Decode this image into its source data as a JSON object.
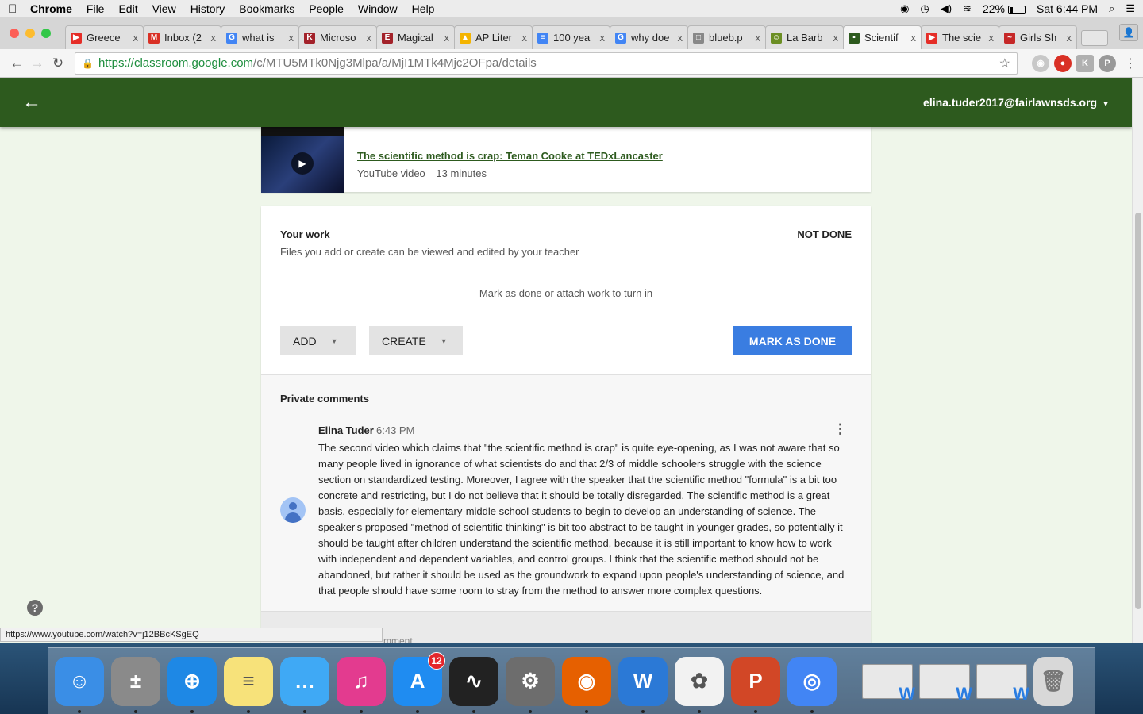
{
  "menubar": {
    "apple": "",
    "app_name": "Chrome",
    "items": [
      "File",
      "Edit",
      "View",
      "History",
      "Bookmarks",
      "People",
      "Window",
      "Help"
    ],
    "battery_percent": "22%",
    "clock": "Sat 6:44 PM"
  },
  "tabs": [
    {
      "label": "Greece",
      "fav_color": "#e52d27",
      "fav_glyph": "▶"
    },
    {
      "label": "Inbox (2",
      "fav_color": "#d93025",
      "fav_glyph": "M"
    },
    {
      "label": "what is",
      "fav_color": "#4285f4",
      "fav_glyph": "G"
    },
    {
      "label": "Microso",
      "fav_color": "#a3222a",
      "fav_glyph": "K"
    },
    {
      "label": "Magical",
      "fav_color": "#a3222a",
      "fav_glyph": "E"
    },
    {
      "label": "AP Liter",
      "fav_color": "#f4b400",
      "fav_glyph": "▲"
    },
    {
      "label": "100 yea",
      "fav_color": "#4285f4",
      "fav_glyph": "≡"
    },
    {
      "label": "why doe",
      "fav_color": "#4285f4",
      "fav_glyph": "G"
    },
    {
      "label": "blueb.p",
      "fav_color": "#888888",
      "fav_glyph": "□"
    },
    {
      "label": "La Barb",
      "fav_color": "#6b8e23",
      "fav_glyph": "☺"
    },
    {
      "label": "Scientif",
      "fav_color": "#2d5a1e",
      "fav_glyph": "▪",
      "active": true
    },
    {
      "label": "The scie",
      "fav_color": "#e52d27",
      "fav_glyph": "▶"
    },
    {
      "label": "Girls Sh",
      "fav_color": "#c62828",
      "fav_glyph": "~"
    }
  ],
  "tab_close": "x",
  "omnibox": {
    "url_secure": "https://classroom.google.com",
    "url_path": "/c/MTU5MTk0Njg3Mlpa/a/MjI1MTk4Mjc2OFpa/details"
  },
  "page": {
    "account": "elina.tuder2017@fairlawnsds.org",
    "video": {
      "title": "The scientific method is crap: Teman Cooke at TEDxLancaster",
      "source": "YouTube video",
      "duration": "13 minutes"
    },
    "work": {
      "title": "Your work",
      "status": "NOT DONE",
      "subtitle": "Files you add or create can be viewed and edited by your teacher",
      "hint": "Mark as done or attach work to turn in",
      "add_label": "ADD",
      "create_label": "CREATE",
      "done_label": "MARK AS DONE"
    },
    "comments": {
      "title": "Private comments",
      "author": "Elina Tuder",
      "time": "6:43 PM",
      "text": "The second video which claims that \"the scientific method is crap\" is quite eye-opening, as I was not aware that so many people lived in ignorance of what scientists do and that 2/3 of middle schoolers struggle with the science section on standardized testing. Moreover, I agree with the speaker that the scientific method \"formula\" is a bit too concrete and restricting, but I do not believe that it should be totally disregarded. The scientific method is a great basis, especially for elementary-middle school students to begin to develop an understanding of science. The speaker's proposed \"method of scientific thinking\" is bit too abstract to be taught in younger grades, so potentially it should be taught after children understand the scientific method, because it is still important to know how to work with independent and dependent variables, and control groups. I think that the scientific method should not be abandoned, but rather it should be used as the groundwork to expand upon people's understanding of science, and that people should have some room to stray from the method to answer more complex questions.",
      "footer_partial": "mment"
    },
    "help": "?",
    "status_url": "https://www.youtube.com/watch?v=j12BBcKSgEQ"
  },
  "dock": {
    "items": [
      {
        "name": "finder",
        "color": "#3a8ee6",
        "glyph": "☺"
      },
      {
        "name": "calculator",
        "color": "#8a8a8a",
        "glyph": "±"
      },
      {
        "name": "safari",
        "color": "#1e88e5",
        "glyph": "⊕"
      },
      {
        "name": "notes",
        "color": "#f7e27a",
        "glyph": "≡"
      },
      {
        "name": "messages",
        "color": "#3fa9f5",
        "glyph": "…"
      },
      {
        "name": "itunes",
        "color": "#e33b8f",
        "glyph": "♫"
      },
      {
        "name": "app-store",
        "color": "#1f8cf1",
        "glyph": "A",
        "badge": "12"
      },
      {
        "name": "activity-monitor",
        "color": "#222222",
        "glyph": "∿"
      },
      {
        "name": "system-preferences",
        "color": "#6d6d6d",
        "glyph": "⚙"
      },
      {
        "name": "firefox",
        "color": "#e66000",
        "glyph": "◉"
      },
      {
        "name": "word",
        "color": "#2b79d6",
        "glyph": "W"
      },
      {
        "name": "photos",
        "color": "#f2f2f2",
        "glyph": "✿"
      },
      {
        "name": "powerpoint",
        "color": "#d24726",
        "glyph": "P"
      },
      {
        "name": "chrome",
        "color": "#4285f4",
        "glyph": "◎"
      }
    ],
    "windows": [
      "W",
      "W",
      "W"
    ]
  }
}
